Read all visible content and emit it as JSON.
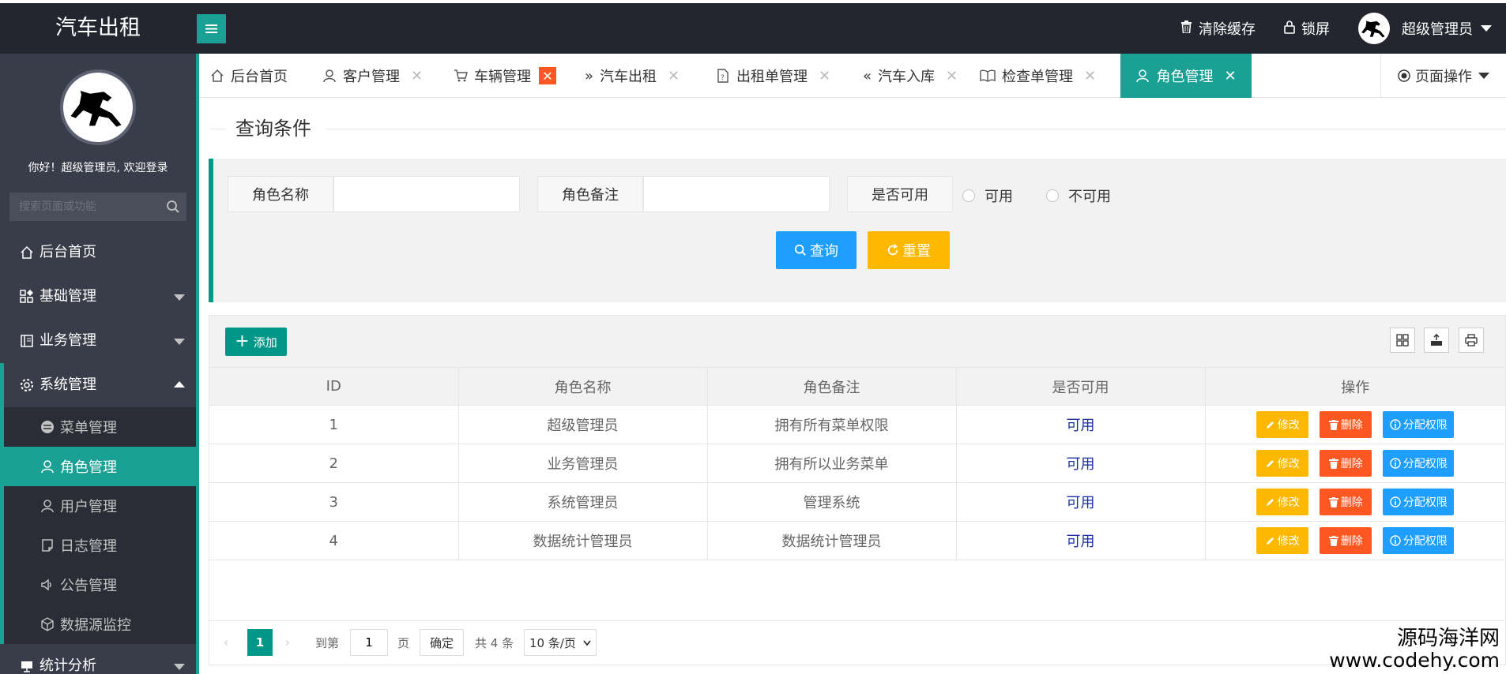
{
  "app": {
    "title": "汽车出租"
  },
  "header": {
    "clear_cache": "清除缓存",
    "lock_screen": "锁屏",
    "user_name": "超级管理员"
  },
  "sidebar": {
    "welcome": "你好！超级管理员, 欢迎登录",
    "search_placeholder": "搜索页面或功能",
    "items": [
      {
        "label": "后台首页",
        "icon": "home-icon"
      },
      {
        "label": "基础管理",
        "icon": "grid-icon"
      },
      {
        "label": "业务管理",
        "icon": "book-icon"
      },
      {
        "label": "系统管理",
        "icon": "gear-icon"
      },
      {
        "label": "统计分析",
        "icon": "chart-icon"
      }
    ],
    "sub_items": [
      {
        "label": "菜单管理",
        "icon": "menu-circle-icon"
      },
      {
        "label": "角色管理",
        "icon": "user-icon"
      },
      {
        "label": "用户管理",
        "icon": "user-icon"
      },
      {
        "label": "日志管理",
        "icon": "note-icon"
      },
      {
        "label": "公告管理",
        "icon": "speaker-icon"
      },
      {
        "label": "数据源监控",
        "icon": "cube-icon"
      }
    ]
  },
  "tabs": [
    {
      "label": "后台首页"
    },
    {
      "label": "客户管理"
    },
    {
      "label": "车辆管理"
    },
    {
      "label": "汽车出租"
    },
    {
      "label": "出租单管理"
    },
    {
      "label": "汽车入库"
    },
    {
      "label": "检查单管理"
    },
    {
      "label": "角色管理"
    }
  ],
  "page_ops": "页面操作",
  "query": {
    "legend": "查询条件",
    "role_name_label": "角色名称",
    "role_remark_label": "角色备注",
    "available_label": "是否可用",
    "opt_available": "可用",
    "opt_unavailable": "不可用",
    "search_btn": "查询",
    "reset_btn": "重置"
  },
  "table": {
    "add_btn": "添加",
    "columns": [
      "ID",
      "角色名称",
      "角色备注",
      "是否可用",
      "操作"
    ],
    "rows": [
      {
        "id": "1",
        "name": "超级管理员",
        "remark": "拥有所有菜单权限",
        "available": "可用"
      },
      {
        "id": "2",
        "name": "业务管理员",
        "remark": "拥有所以业务菜单",
        "available": "可用"
      },
      {
        "id": "3",
        "name": "系统管理员",
        "remark": "管理系统",
        "available": "可用"
      },
      {
        "id": "4",
        "name": "数据统计管理员",
        "remark": "数据统计管理员",
        "available": "可用"
      }
    ],
    "edit_btn": "修改",
    "delete_btn": "删除",
    "assign_btn": "分配权限"
  },
  "pager": {
    "current_page": "1",
    "goto_label": "到第",
    "goto_value": "1",
    "page_unit": "页",
    "confirm": "确定",
    "total": "共 4 条",
    "page_size": "10 条/页"
  },
  "watermark": {
    "line1": "源码海洋网",
    "line2": "www.codehy.com"
  },
  "colors": {
    "accent": "#1aa094",
    "primary": "#009688",
    "warm": "#ffb800",
    "danger": "#ff5722",
    "normal": "#1e9fff",
    "dark": "#23262e",
    "sidebar": "#393d49"
  }
}
